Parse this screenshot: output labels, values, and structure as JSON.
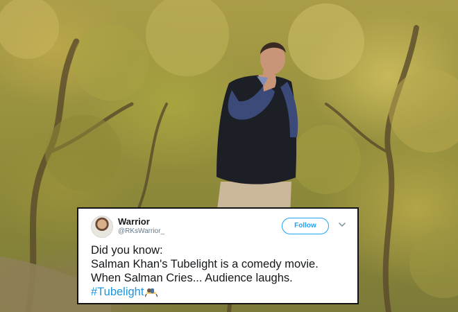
{
  "tweet": {
    "display_name": "Warrior",
    "handle": "@RKsWarrior_",
    "follow_label": "Follow",
    "lines": [
      "Did you know:",
      "Salman Khan's Tubelight is a comedy movie.",
      "When Salman Cries... Audience laughs."
    ],
    "hashtag": "#Tubelight"
  },
  "colors": {
    "accent": "#1da1f2",
    "hashtag": "#1b95e0",
    "text": "#14171a",
    "secondary": "#657786",
    "card_border": "#111111"
  },
  "icons": [
    "avatar",
    "chevron-down-icon",
    "hashtag-emoji-icon"
  ]
}
